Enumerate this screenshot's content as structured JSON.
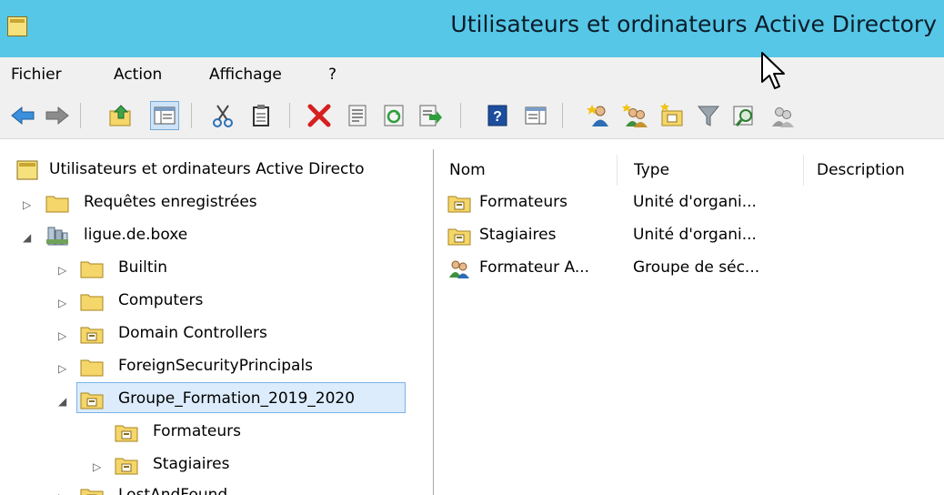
{
  "window": {
    "title": "Utilisateurs et ordinateurs Active Directory"
  },
  "menu": [
    "Fichier",
    "Action",
    "Affichage",
    "?"
  ],
  "toolbar": {
    "icons": [
      "back-icon",
      "forward-icon",
      "up-folder-icon",
      "show-console-tree-icon",
      "cut-icon",
      "paste-icon",
      "delete-icon",
      "properties-icon",
      "refresh-icon",
      "export-list-icon",
      "help-icon",
      "show-action-pane-icon",
      "new-user-icon",
      "new-group-icon",
      "new-ou-icon",
      "filter-icon",
      "find-icon",
      "add-to-group-icon"
    ]
  },
  "tree": {
    "root": "Utilisateurs et ordinateurs Active Directo",
    "items": [
      {
        "label": "Requêtes enregistrées",
        "level": 1,
        "expander": "collapsed",
        "icon": "folder-icon"
      },
      {
        "label": "ligue.de.boxe",
        "level": 1,
        "expander": "expanded",
        "icon": "domain-icon"
      },
      {
        "label": "Builtin",
        "level": 2,
        "expander": "collapsed",
        "icon": "folder-icon"
      },
      {
        "label": "Computers",
        "level": 2,
        "expander": "collapsed",
        "icon": "folder-icon"
      },
      {
        "label": "Domain Controllers",
        "level": 2,
        "expander": "collapsed",
        "icon": "ou-icon"
      },
      {
        "label": "ForeignSecurityPrincipals",
        "level": 2,
        "expander": "collapsed",
        "icon": "folder-icon"
      },
      {
        "label": "Groupe_Formation_2019_2020",
        "level": 2,
        "expander": "expanded",
        "icon": "ou-icon",
        "selected": true
      },
      {
        "label": "Formateurs",
        "level": 3,
        "expander": "none",
        "icon": "ou-icon"
      },
      {
        "label": "Stagiaires",
        "level": 3,
        "expander": "collapsed",
        "icon": "ou-icon"
      },
      {
        "label": "LostAndFound",
        "level": 2,
        "expander": "collapsed",
        "icon": "ou-icon"
      }
    ]
  },
  "list": {
    "columns": [
      "Nom",
      "Type",
      "Description"
    ],
    "rows": [
      {
        "name": "Formateurs",
        "type": "Unité d'organi...",
        "icon": "ou-icon"
      },
      {
        "name": "Stagiaires",
        "type": "Unité d'organi...",
        "icon": "ou-icon"
      },
      {
        "name": "Formateur A...",
        "type": "Groupe de séc...",
        "icon": "group-icon"
      }
    ]
  },
  "colors": {
    "titlebar": "#56c7e6",
    "menubar": "#f0f0f0",
    "selection": "#dcecfc",
    "folder": "#f5d66a"
  }
}
